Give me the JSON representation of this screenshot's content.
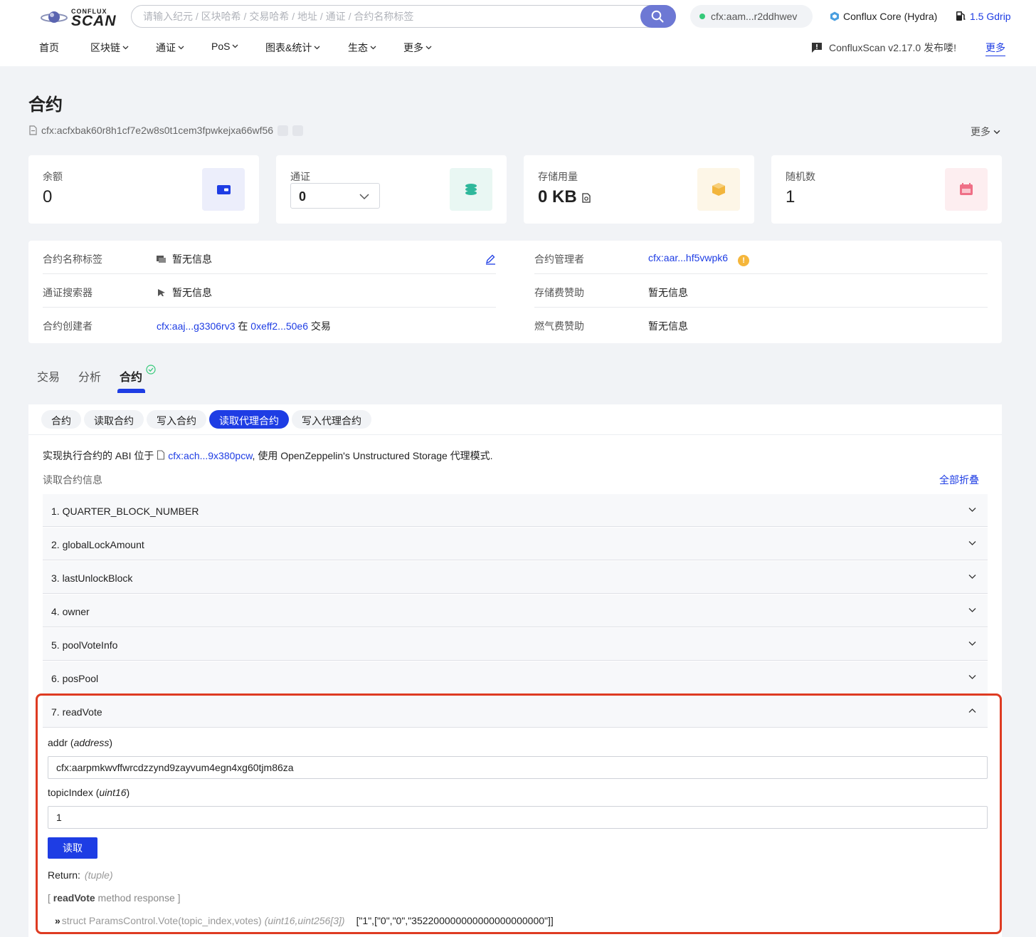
{
  "header": {
    "brand_top": "CONFLUX",
    "brand_main": "SCAN",
    "search_placeholder": "请输入纪元 / 区块哈希 / 交易哈希 / 地址 / 通证 / 合约名称标签",
    "wallet_address": "cfx:aam...r2ddhwev",
    "network": "Conflux Core (Hydra)",
    "gas_price": "1.5 Gdrip",
    "nav": [
      "首页",
      "区块链",
      "通证",
      "PoS",
      "图表&统计",
      "生态",
      "更多"
    ],
    "announcement": "ConfluxScan v2.17.0 发布喽!",
    "more_link": "更多"
  },
  "page": {
    "title": "合约",
    "address": "cfx:acfxbak60r8h1cf7e2w8s0t1cem3fpwkejxa66wf56",
    "more_dropdown": "更多"
  },
  "cards": {
    "balance": {
      "label": "余额",
      "value": "0"
    },
    "token": {
      "label": "通证",
      "value": "0"
    },
    "storage": {
      "label": "存储用量",
      "value": "0 KB"
    },
    "nonce": {
      "label": "随机数",
      "value": "1"
    }
  },
  "info": {
    "left": [
      {
        "key": "合约名称标签",
        "value": "暂无信息"
      },
      {
        "key": "通证搜索器",
        "value": "暂无信息"
      },
      {
        "key": "合约创建者",
        "creator": "cfx:aaj...g3306rv3",
        "at": "在",
        "tx": "0xeff2...50e6",
        "tx_label": "交易"
      }
    ],
    "right": [
      {
        "key": "合约管理者",
        "value": "cfx:aar...hf5vwpk6"
      },
      {
        "key": "存储费赞助",
        "value": "暂无信息"
      },
      {
        "key": "燃气费赞助",
        "value": "暂无信息"
      }
    ]
  },
  "tabs": [
    "交易",
    "分析",
    "合约"
  ],
  "subtabs": [
    "合约",
    "读取合约",
    "写入合约",
    "读取代理合约",
    "写入代理合约"
  ],
  "contract": {
    "impl_prefix": "实现执行合约的 ABI 位于",
    "impl_address": "cfx:ach...9x380pcw",
    "impl_suffix": ", 使用 OpenZeppelin's Unstructured Storage 代理模式.",
    "read_title": "读取合约信息",
    "collapse_all": "全部折叠",
    "methods": [
      "1. QUARTER_BLOCK_NUMBER",
      "2. globalLockAmount",
      "3. lastUnlockBlock",
      "4. owner",
      "5. poolVoteInfo",
      "6. posPool",
      "7. readVote"
    ],
    "readVote": {
      "param1_name": "addr",
      "param1_type": "address",
      "param1_value": "cfx:aarpmkwvffwrcdzzynd9zayvum4egn4xg60tjm86za",
      "param2_name": "topicIndex",
      "param2_type": "uint16",
      "param2_value": "1",
      "read_button": "读取",
      "return_label": "Return:",
      "return_type": "(tuple)",
      "response_open": "[",
      "response_method": "readVote",
      "response_text": "method response ]",
      "struct_arrow": "»",
      "struct_sig": "struct ParamsControl.Vote(topic_index,votes)",
      "struct_types": "(uint16,uint256[3])",
      "struct_result": "[\"1\",[\"0\",\"0\",\"352200000000000000000000\"]]"
    }
  },
  "colors": {
    "accent": "#1e3de4",
    "highlight_border": "#de3b22",
    "success": "#35c979",
    "warning": "#f5b63b"
  }
}
